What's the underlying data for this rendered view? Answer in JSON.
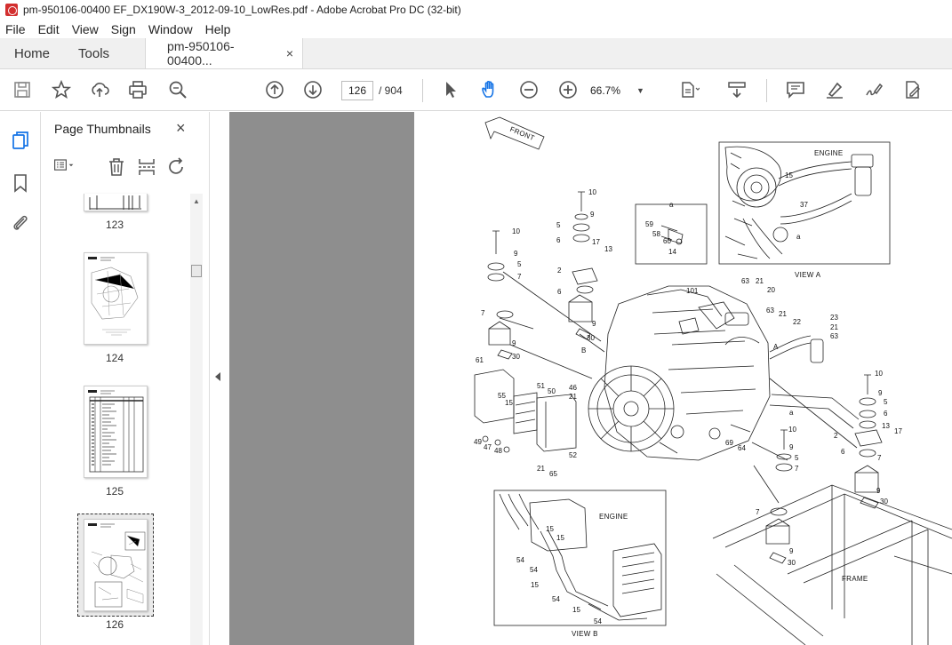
{
  "window": {
    "title": "pm-950106-00400 EF_DX190W-3_2012-09-10_LowRes.pdf - Adobe Acrobat Pro DC (32-bit)"
  },
  "menu": [
    "File",
    "Edit",
    "View",
    "Sign",
    "Window",
    "Help"
  ],
  "tabs": {
    "home": "Home",
    "tools": "Tools",
    "document": "pm-950106-00400...",
    "close_glyph": "×"
  },
  "toolbar": {
    "current_page": "126",
    "total_pages": "/ 904",
    "zoom": "66.7%",
    "icons": [
      "save-icon",
      "star-icon",
      "share-upload-icon",
      "print-icon",
      "search-icon",
      "prev-page-icon",
      "next-page-icon",
      "select-cursor-icon",
      "hand-tool-icon",
      "zoom-out-icon",
      "zoom-in-icon",
      "fit-page-icon",
      "scroll-mode-icon",
      "comment-icon",
      "highlight-icon",
      "sign-icon",
      "edit-pdf-icon"
    ]
  },
  "thumbnails": {
    "title": "Page Thumbnails",
    "close_glyph": "×",
    "pages": [
      "123",
      "124",
      "125",
      "126"
    ],
    "selected": "126"
  },
  "drawing": {
    "front": "FRONT",
    "engine_top": "ENGINE",
    "view_a": "VIEW  A",
    "engine_bottom": "ENGINE",
    "view_b": "VIEW  B",
    "frame": "FRAME",
    "callout_a": "a",
    "arrow_a": "A",
    "arrow_b": "B",
    "labels": [
      "10",
      "9",
      "5",
      "6",
      "17",
      "13",
      "2",
      "6",
      "9",
      "30",
      "10",
      "9",
      "5",
      "7",
      "7",
      "9",
      "30",
      "61",
      "55",
      "15",
      "51",
      "50",
      "46",
      "21",
      "49",
      "47",
      "48",
      "21",
      "65",
      "52",
      "101",
      "63",
      "21",
      "20",
      "63",
      "21",
      "22",
      "23",
      "21",
      "63",
      "69",
      "64",
      "10",
      "9",
      "5",
      "7",
      "10",
      "9",
      "5",
      "6",
      "13",
      "17",
      "2",
      "6",
      "7",
      "9",
      "30",
      "7",
      "9",
      "30",
      "59",
      "58",
      "60",
      "14",
      "15",
      "37",
      "15",
      "15",
      "54",
      "54",
      "15",
      "54",
      "15",
      "54"
    ]
  }
}
